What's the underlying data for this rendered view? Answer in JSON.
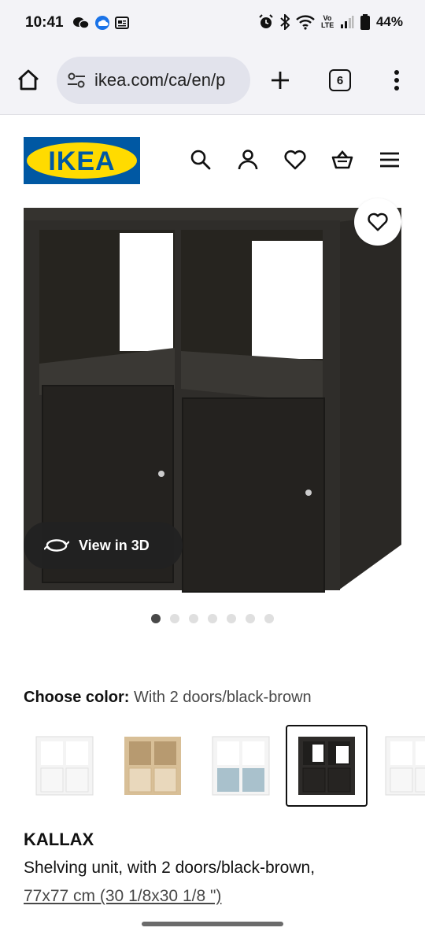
{
  "status_bar": {
    "time": "10:41",
    "battery": "44%",
    "signal_label": "Vo LTE"
  },
  "browser": {
    "url": "ikea.com/ca/en/p",
    "tab_count": "6"
  },
  "header": {
    "logo_text": "IKEA",
    "logo_colors": {
      "blue": "#0058a3",
      "yellow": "#ffdb00"
    }
  },
  "gallery": {
    "view_3d_label": "View in 3D",
    "dot_count": 7,
    "active_dot": 0
  },
  "color_chooser": {
    "label": "Choose color:",
    "value": "With 2 doors/black-brown",
    "options": [
      {
        "name": "white",
        "body": "#f4f4f4",
        "doors": "#f4f4f4"
      },
      {
        "name": "white-stained-oak",
        "body": "#e6d3b6",
        "doors": "#e6d3b6"
      },
      {
        "name": "white-light-blue",
        "body": "#f4f4f4",
        "doors": "#a9c1cc"
      },
      {
        "name": "black-brown",
        "body": "#2d2b29",
        "doors": "#2d2b29",
        "selected": true
      },
      {
        "name": "white-partial",
        "body": "#f4f4f4",
        "doors": "#f4f4f4"
      }
    ]
  },
  "product": {
    "name": "KALLAX",
    "description": "Shelving unit, with 2 doors/black-brown,",
    "size": "77x77 cm (30 1/8x30 1/8 \")"
  }
}
